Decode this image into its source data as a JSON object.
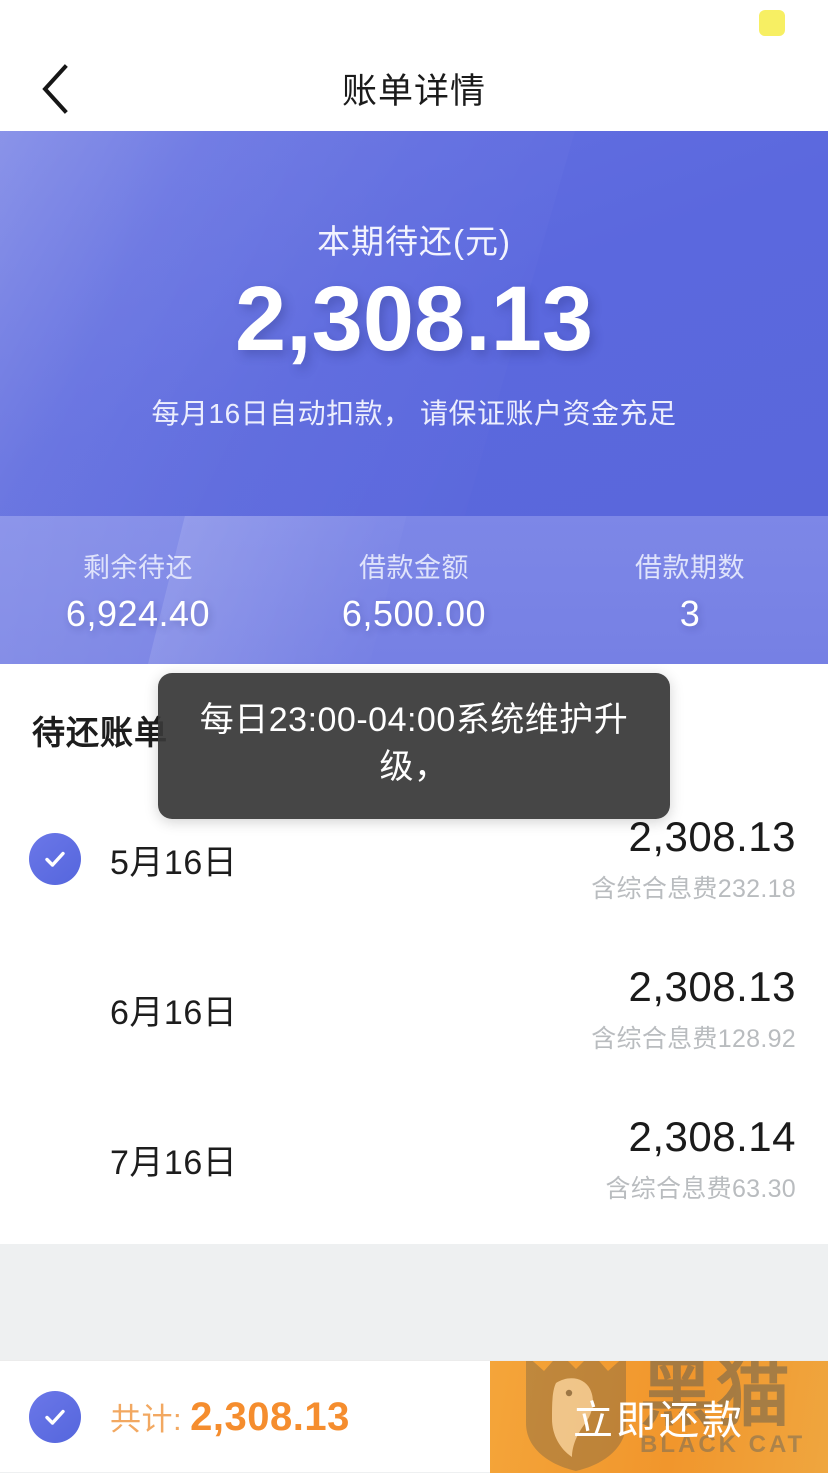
{
  "statusbar": {
    "badge_color": "#f7ef63"
  },
  "nav": {
    "back_icon": "chevron-left-icon",
    "title": "账单详情"
  },
  "hero": {
    "label": "本期待还(元)",
    "amount": "2,308.13",
    "note": "每月16日自动扣款， 请保证账户资金充足",
    "bg_color": "#5b68de"
  },
  "stats": [
    {
      "label": "剩余待还",
      "value": "6,924.40"
    },
    {
      "label": "借款金额",
      "value": "6,500.00"
    },
    {
      "label": "借款期数",
      "value": "3"
    }
  ],
  "bills": {
    "section_title": "待还账单",
    "rows": [
      {
        "checked": true,
        "date": "5月16日",
        "amount": "2,308.13",
        "fee": "含综合息费232.18"
      },
      {
        "checked": false,
        "date": "6月16日",
        "amount": "2,308.13",
        "fee": "含综合息费128.92"
      },
      {
        "checked": false,
        "date": "7月16日",
        "amount": "2,308.14",
        "fee": "含综合息费63.30"
      }
    ]
  },
  "toast": {
    "message": "每日23:00-04:00系统维护升级，"
  },
  "bottombar": {
    "checked": true,
    "total_label": "共计:",
    "total_value": "2,308.13",
    "total_color": "#f58d2e",
    "pay_label": "立即还款",
    "pay_color": "#f1962c",
    "watermark_cn": "黑猫",
    "watermark_en": "BLACK CAT"
  }
}
